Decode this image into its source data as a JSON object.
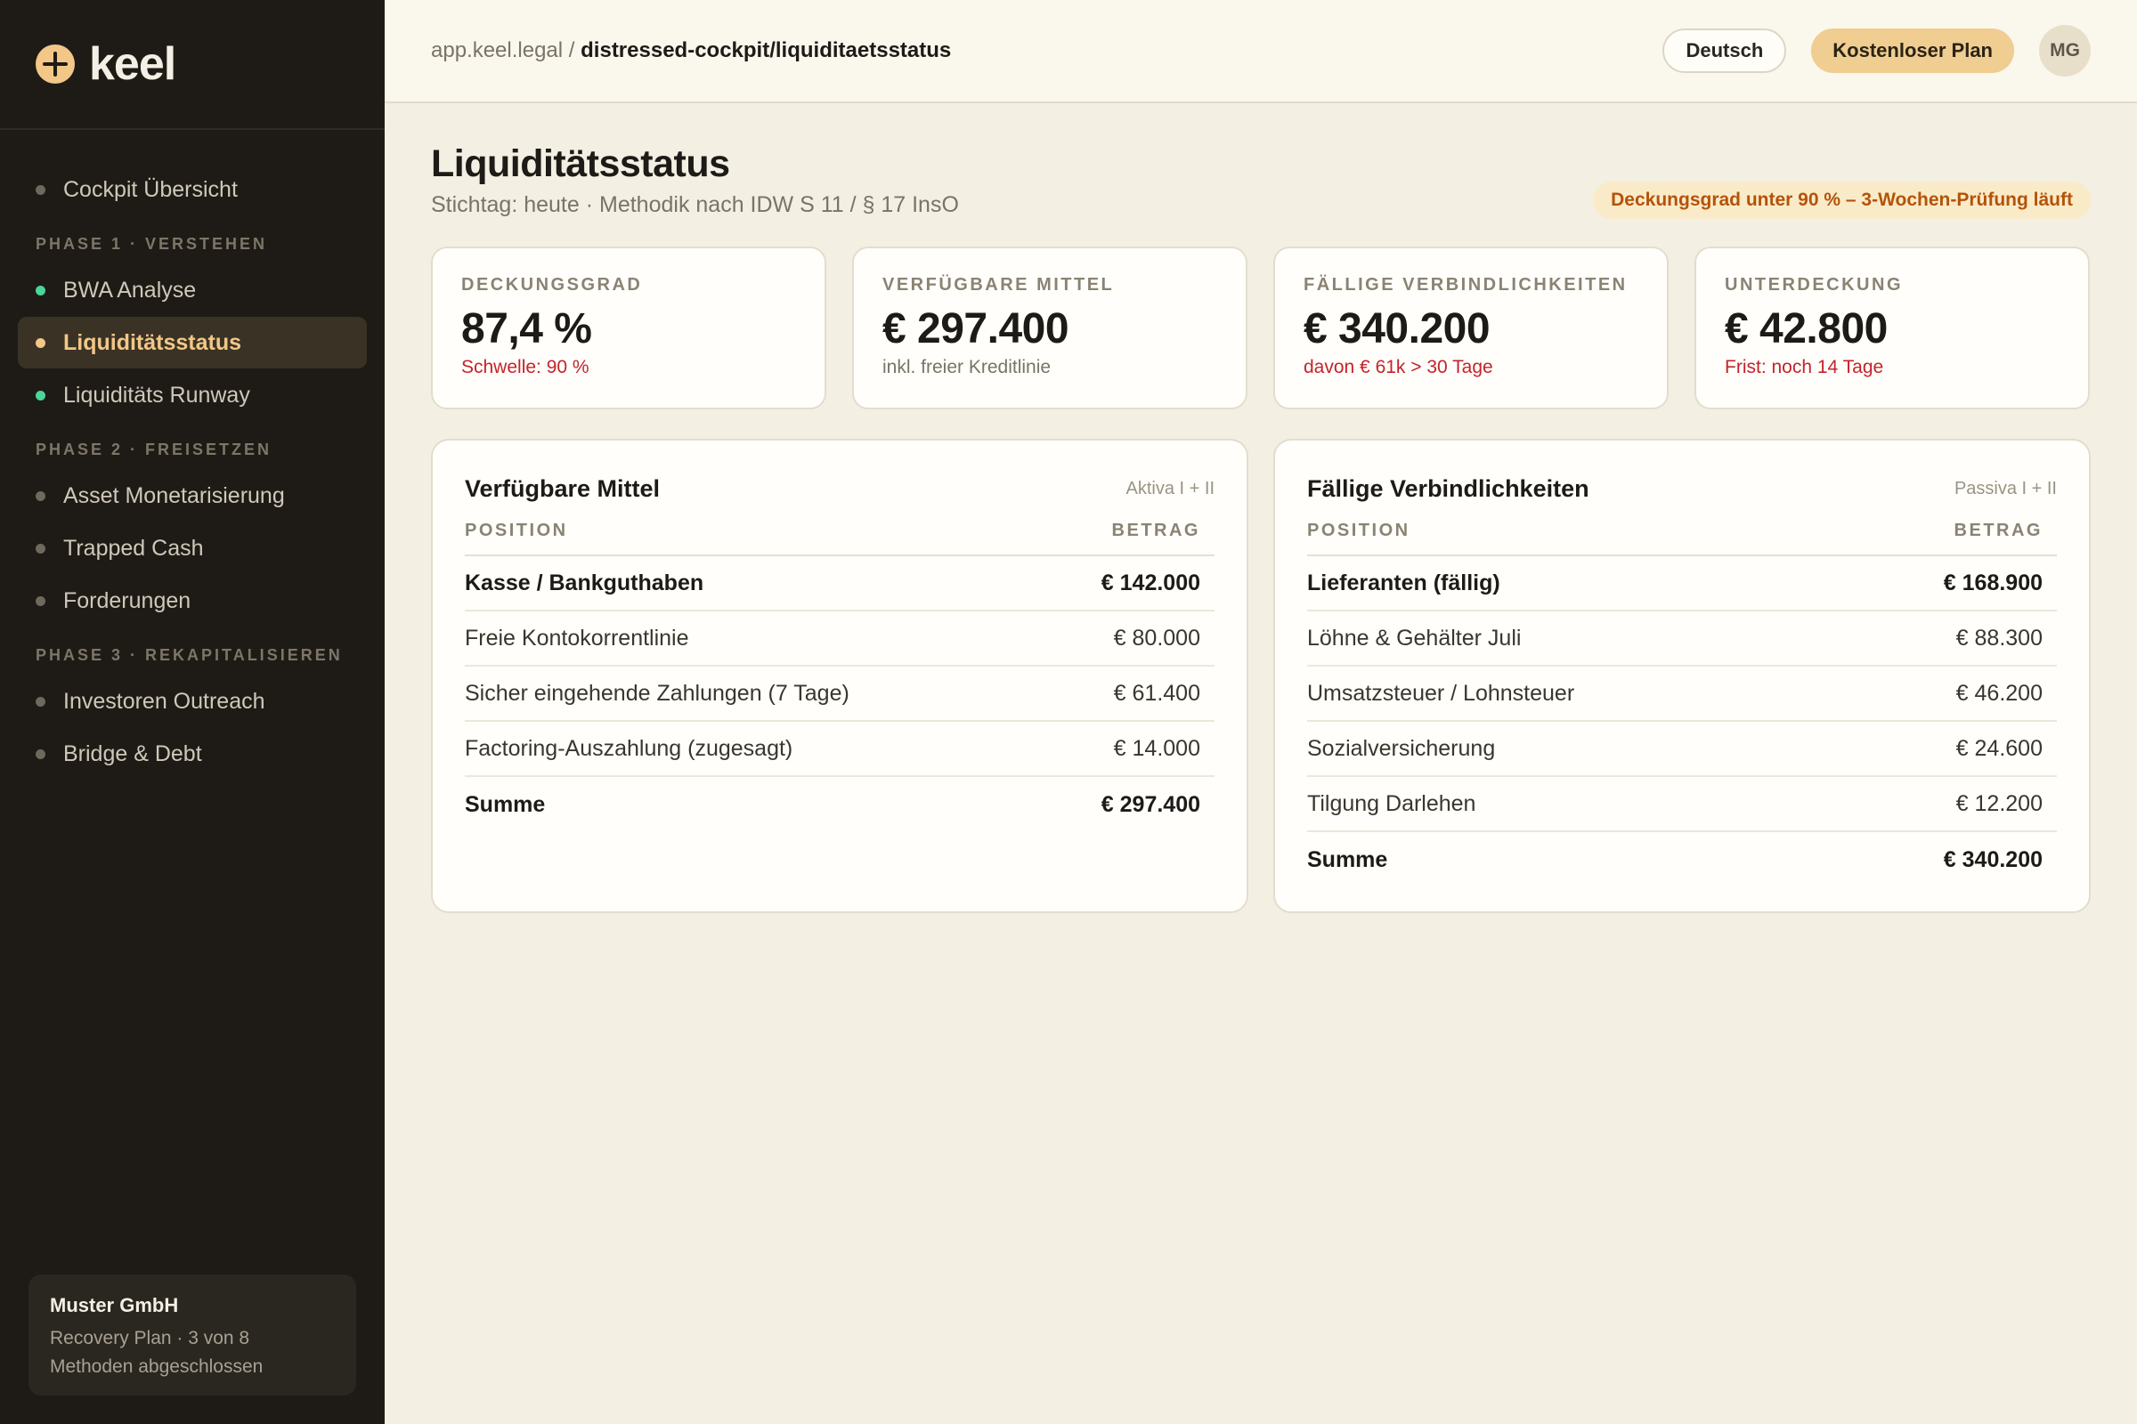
{
  "brand": {
    "name": "keel"
  },
  "sidebar": {
    "top_item": {
      "label": "Cockpit Übersicht"
    },
    "phases": [
      {
        "title": "PHASE 1 · VERSTEHEN",
        "items": [
          {
            "label": "BWA Analyse",
            "state": "done"
          },
          {
            "label": "Liquiditätsstatus",
            "state": "active"
          },
          {
            "label": "Liquiditäts Runway",
            "state": "done"
          }
        ]
      },
      {
        "title": "PHASE 2 · FREISETZEN",
        "items": [
          {
            "label": "Asset Monetarisierung",
            "state": "todo"
          },
          {
            "label": "Trapped Cash",
            "state": "todo"
          },
          {
            "label": "Forderungen",
            "state": "todo"
          }
        ]
      },
      {
        "title": "PHASE 3 · REKAPITALISIEREN",
        "items": [
          {
            "label": "Investoren Outreach",
            "state": "todo"
          },
          {
            "label": "Bridge & Debt",
            "state": "todo"
          }
        ]
      }
    ],
    "company": {
      "name": "Muster GmbH",
      "progress_text": "Recovery Plan · 3 von 8 Methoden abgeschlossen"
    }
  },
  "topbar": {
    "domain": "app.keel.legal",
    "separator": " / ",
    "path": "distressed-cockpit/liquiditaetsstatus",
    "language_button": "Deutsch",
    "plan_button": "Kostenloser Plan",
    "avatar_initials": "MG"
  },
  "page": {
    "title": "Liquiditätsstatus",
    "subtitle": "Stichtag: heute · Methodik nach IDW S 11 / § 17 InsO",
    "alert": "Deckungsgrad unter 90 % – 3-Wochen-Prüfung läuft"
  },
  "kpis": [
    {
      "label": "DECKUNGSGRAD",
      "value": "87,4 %",
      "note": "Schwelle: 90 %",
      "note_warn": true
    },
    {
      "label": "VERFÜGBARE MITTEL",
      "value": "€ 297.400",
      "note": "inkl. freier Kreditlinie",
      "note_warn": false
    },
    {
      "label": "FÄLLIGE VERBINDLICHKEITEN",
      "value": "€ 340.200",
      "note": "davon € 61k > 30 Tage",
      "note_warn": true
    },
    {
      "label": "UNTERDECKUNG",
      "value": "€ 42.800",
      "note": "Frist: noch 14 Tage",
      "note_warn": true
    }
  ],
  "assets": {
    "title": "Verfügbare Mittel",
    "tag": "Aktiva I + II",
    "col_position": "POSITION",
    "col_amount": "BETRAG",
    "rows": [
      {
        "position": "Kasse / Bankguthaben",
        "amount": "€ 142.000",
        "bold": true
      },
      {
        "position": "Freie Kontokorrentlinie",
        "amount": "€ 80.000",
        "bold": false
      },
      {
        "position": "Sicher eingehende Zahlungen (7 Tage)",
        "amount": "€ 61.400",
        "bold": false
      },
      {
        "position": "Factoring-Auszahlung (zugesagt)",
        "amount": "€ 14.000",
        "bold": false
      },
      {
        "position": "Summe",
        "amount": "€ 297.400",
        "bold": true
      }
    ]
  },
  "liabilities": {
    "title": "Fällige Verbindlichkeiten",
    "tag": "Passiva I + II",
    "col_position": "POSITION",
    "col_amount": "BETRAG",
    "rows": [
      {
        "position": "Lieferanten (fällig)",
        "amount": "€ 168.900",
        "bold": true
      },
      {
        "position": "Löhne & Gehälter Juli",
        "amount": "€ 88.300",
        "bold": false
      },
      {
        "position": "Umsatzsteuer / Lohnsteuer",
        "amount": "€ 46.200",
        "bold": false
      },
      {
        "position": "Sozialversicherung",
        "amount": "€ 24.600",
        "bold": false
      },
      {
        "position": "Tilgung Darlehen",
        "amount": "€ 12.200",
        "bold": false
      },
      {
        "position": "Summe",
        "amount": "€ 340.200",
        "bold": true
      }
    ]
  },
  "colors": {
    "sidebar_bg": "#1e1b16",
    "accent": "#f2c787",
    "done_dot": "#4ad699",
    "warn_text": "#c4232b",
    "alert_text": "#b45309",
    "alert_bg": "#faebc8",
    "page_bg": "#f3efe3"
  },
  "icons": {
    "brand_logo": "compass-star-icon",
    "status_dot": "dot-icon"
  }
}
